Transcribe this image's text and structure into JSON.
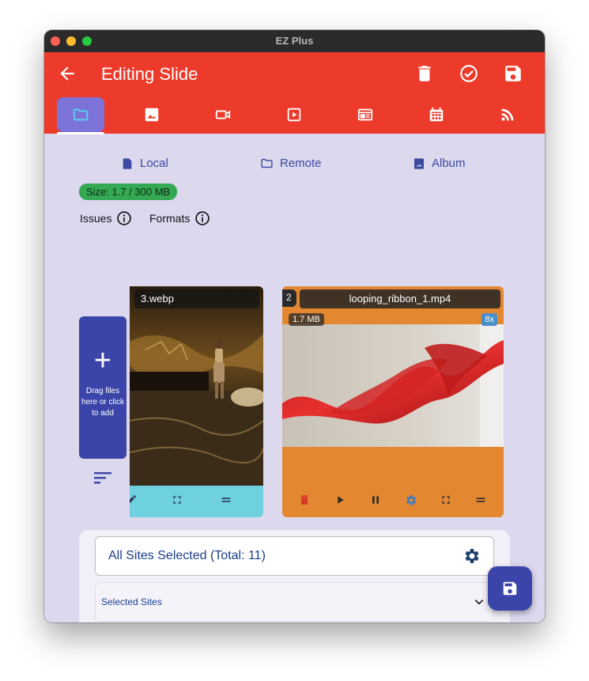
{
  "window": {
    "title": "EZ Plus"
  },
  "appbar": {
    "title": "Editing Slide"
  },
  "tabs": [
    {
      "icon": "folder-icon"
    },
    {
      "icon": "image-icon"
    },
    {
      "icon": "videocam-icon"
    },
    {
      "icon": "slideshow-icon"
    },
    {
      "icon": "web-icon"
    },
    {
      "icon": "calendar-icon"
    },
    {
      "icon": "rss-icon"
    }
  ],
  "sources": {
    "local": "Local",
    "remote": "Remote",
    "album": "Album"
  },
  "size": {
    "label": "Size: 1.7 / 300 MB"
  },
  "info": {
    "issues": "Issues",
    "formats": "Formats"
  },
  "add_card": {
    "plus": "+",
    "text": "Drag files here or click to add"
  },
  "media": [
    {
      "name": "3.webp"
    },
    {
      "index": "2",
      "name": "looping_ribbon_1.mp4",
      "size": "1.7 MB",
      "speed": "8x"
    }
  ],
  "sites": {
    "selected_text": "All Sites Selected (Total: 11)",
    "dropdown_label": "Selected Sites"
  },
  "colors": {
    "appbar": "#ec3a2b",
    "active_tab": "#7b73d8",
    "primary": "#3b45a9",
    "video_card": "#e48731",
    "image_card_bar": "#6fd1df",
    "size_badge": "#34a853"
  }
}
